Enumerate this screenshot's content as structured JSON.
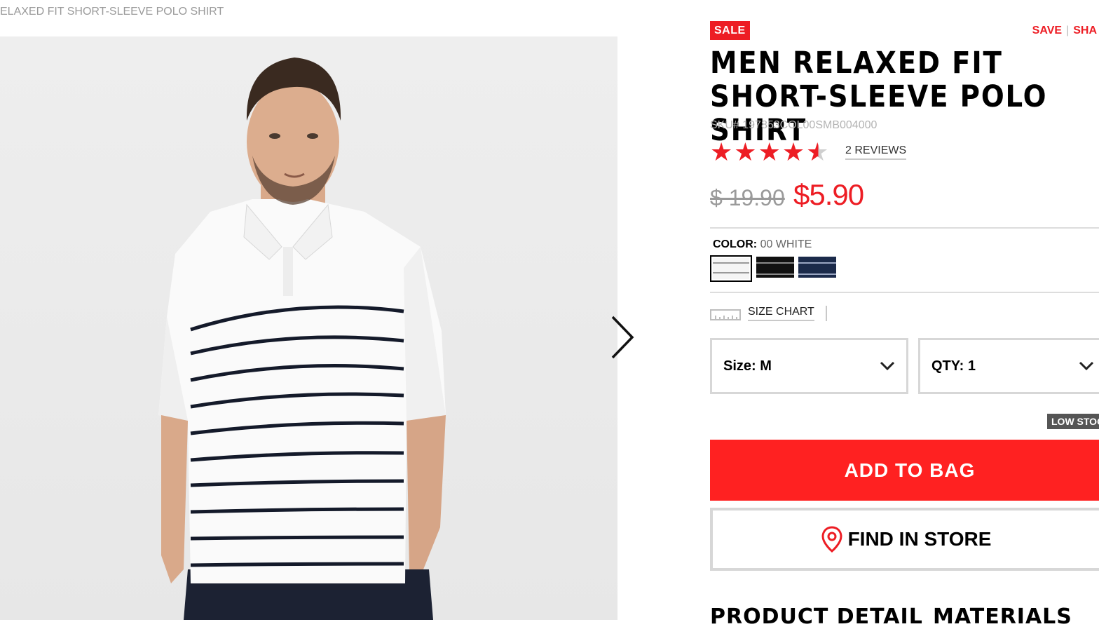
{
  "breadcrumb": "ELAXED FIT SHORT-SLEEVE POLO SHIRT",
  "product": {
    "sale_badge": "SALE",
    "save_label": "SAVE",
    "share_label": "SHA",
    "title": "MEN RELAXED FIT SHORT-SLEEVE POLO SHIRT",
    "sku": "SKU# 197853COL00SMB004000",
    "rating": 4.5,
    "rating_max": 5,
    "reviews_label": "2 REVIEWS",
    "price_old": "$ 19.90",
    "price_new": "$5.90",
    "color_key": "COLOR:",
    "color_value": "00 WHITE",
    "swatches": [
      {
        "name": "white-stripe",
        "base": "#f5f5f5",
        "stripe": "#222222"
      },
      {
        "name": "black-stripe",
        "base": "#111111",
        "stripe": "#9a9a9a"
      },
      {
        "name": "navy-stripe",
        "base": "#1b2a4a",
        "stripe": "#9aa6c2"
      }
    ],
    "size_chart_label": "SIZE CHART",
    "size_label": "Size: M",
    "qty_label": "QTY: 1",
    "low_stock": "LOW STOC",
    "add_to_bag": "ADD TO BAG",
    "find_in_store": "FIND IN STORE",
    "product_detail_heading": "PRODUCT DETAIL",
    "materials_heading": "MATERIALS"
  },
  "colors": {
    "accent": "#ed1d24",
    "button_red": "#ff2121"
  }
}
